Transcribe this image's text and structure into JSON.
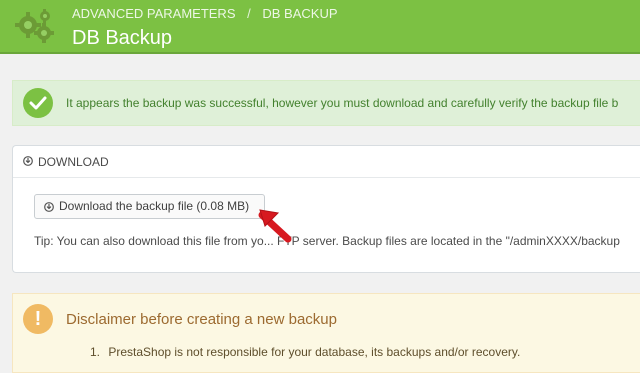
{
  "header": {
    "breadcrumb": [
      "ADVANCED PARAMETERS",
      "DB BACKUP"
    ],
    "title": "DB Backup"
  },
  "alerts": {
    "success": "It appears the backup was successful, however you must download and carefully verify the backup file b"
  },
  "download": {
    "heading": "DOWNLOAD",
    "button_label": "Download the backup file (0.08 MB)",
    "tip": "Tip: You can also download this file from yo... FTP server. Backup files are located in the \"/adminXXXX/backup"
  },
  "warning": {
    "title": "Disclaimer before creating a new backup",
    "items": [
      {
        "number": "1.",
        "text": "PrestaShop is not responsible for your database, its backups and/or recovery."
      }
    ]
  },
  "colors": {
    "header": "#7cc143",
    "success_bg": "#dff0d8",
    "success_text": "#43812e",
    "warning_bg": "#fcf8e3",
    "warning_icon": "#f0ba63",
    "arrow": "#d71920"
  },
  "icons": {
    "header": "gear-icon",
    "success": "check-circle-icon",
    "download_heading": "download-circle-icon",
    "download_button": "download-circle-icon",
    "warning": "exclamation-circle-icon",
    "annotation": "red-arrow-icon"
  }
}
